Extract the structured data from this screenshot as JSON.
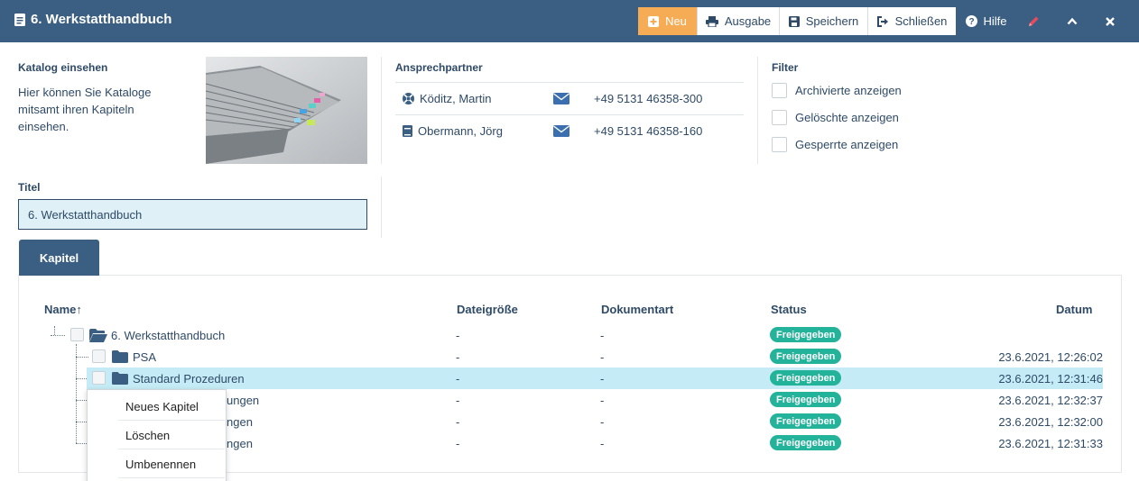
{
  "header": {
    "title": "6. Werkstatthandbuch",
    "buttons": {
      "new": "Neu",
      "print": "Ausgabe",
      "save": "Speichern",
      "close": "Schließen",
      "help": "Hilfe"
    }
  },
  "catalog": {
    "label": "Katalog einsehen",
    "description": "Hier können Sie Kataloge mitsamt ihren Kapiteln einsehen."
  },
  "contacts": {
    "label": "Ansprechpartner",
    "items": [
      {
        "name": "Köditz, Martin",
        "icon": "support-icon",
        "phone": "+49 5131 46358-300"
      },
      {
        "name": "Obermann, Jörg",
        "icon": "book-icon",
        "phone": "+49 5131 46358-160"
      }
    ]
  },
  "filter": {
    "label": "Filter",
    "options": [
      "Archivierte anzeigen",
      "Gelöschte anzeigen",
      "Gesperrte anzeigen"
    ]
  },
  "titel": {
    "label": "Titel",
    "value": "6. Werkstatthandbuch"
  },
  "tabs": {
    "chapters": "Kapitel"
  },
  "table": {
    "headers": {
      "name": "Name↑",
      "size": "Dateigröße",
      "type": "Dokumentart",
      "status": "Status",
      "date": "Datum"
    },
    "rows": [
      {
        "name": "6. Werkstatthandbuch",
        "size": "-",
        "type": "-",
        "status": "Freigegeben",
        "date": ""
      },
      {
        "name": "PSA",
        "size": "-",
        "type": "-",
        "status": "Freigegeben",
        "date": "23.6.2021, 12:26:02"
      },
      {
        "name": "Standard Prozeduren",
        "size": "-",
        "type": "-",
        "status": "Freigegeben",
        "date": "23.6.2021, 12:31:46"
      },
      {
        "name": "ungen",
        "size": "-",
        "type": "-",
        "status": "Freigegeben",
        "date": "23.6.2021, 12:32:37"
      },
      {
        "name": "ngen",
        "size": "-",
        "type": "-",
        "status": "Freigegeben",
        "date": "23.6.2021, 12:32:00"
      },
      {
        "name": "ngen",
        "size": "-",
        "type": "-",
        "status": "Freigegeben",
        "date": "23.6.2021, 12:31:33"
      }
    ]
  },
  "context_menu": {
    "items": [
      "Neues Kapitel",
      "Löschen",
      "Umbenennen"
    ]
  },
  "colors": {
    "header_bg": "#3b5f83",
    "accent_orange": "#f5ac55",
    "status_green": "#23b29a",
    "selected_row": "#c5ecf6"
  }
}
